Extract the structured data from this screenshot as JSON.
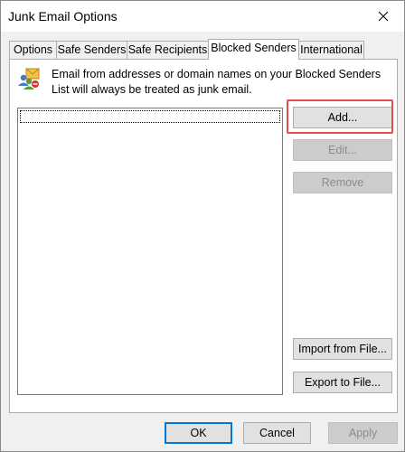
{
  "window": {
    "title": "Junk Email Options"
  },
  "tabs": [
    {
      "label": "Options",
      "active": false
    },
    {
      "label": "Safe Senders",
      "active": false
    },
    {
      "label": "Safe Recipients",
      "active": false
    },
    {
      "label": "Blocked Senders",
      "active": true
    },
    {
      "label": "International",
      "active": false
    }
  ],
  "panel": {
    "icon": "blocked-senders-people-icon",
    "description": "Email from addresses or domain names on your Blocked Senders List will always be treated as junk email.",
    "list_items": [],
    "buttons": {
      "add": "Add...",
      "edit": "Edit...",
      "remove": "Remove",
      "import": "Import from File...",
      "export": "Export to File..."
    }
  },
  "footer": {
    "ok": "OK",
    "cancel": "Cancel",
    "apply": "Apply"
  },
  "colors": {
    "highlight": "#e74c4c",
    "focus_border": "#0078d7",
    "window_bg": "#f0f0f0"
  }
}
